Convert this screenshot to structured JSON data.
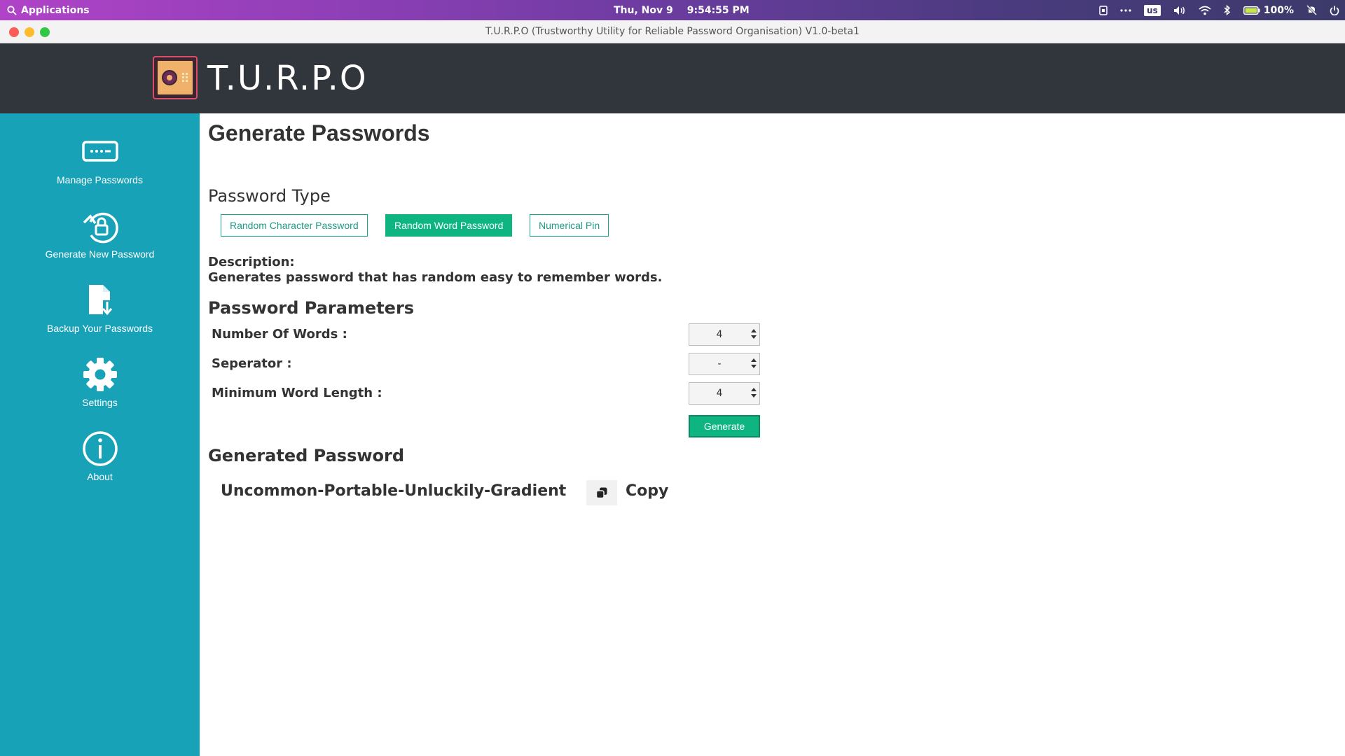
{
  "system_bar": {
    "applications_label": "Applications",
    "date": "Thu, Nov 9",
    "time": "9:54:55 PM",
    "keyboard_layout": "us",
    "battery": "100%"
  },
  "window": {
    "title": "T.U.R.P.O (Trustworthy Utility for Reliable Password Organisation) V1.0-beta1"
  },
  "app": {
    "name": "T.U.R.P.O"
  },
  "sidebar": {
    "items": [
      {
        "label": "Manage Passwords",
        "icon": "password-dots-icon"
      },
      {
        "label": "Generate New Password",
        "icon": "rotate-lock-icon"
      },
      {
        "label": "Backup Your Passwords",
        "icon": "file-download-icon"
      },
      {
        "label": "Settings",
        "icon": "gear-icon"
      },
      {
        "label": "About",
        "icon": "info-icon"
      }
    ]
  },
  "main": {
    "page_title": "Generate Passwords",
    "password_type": {
      "heading": "Password Type",
      "options": [
        "Random Character Password",
        "Random Word Password",
        "Numerical Pin"
      ],
      "selected": "Random Word Password"
    },
    "description": {
      "label": "Description:",
      "text": "Generates password that has random easy to remember words."
    },
    "parameters": {
      "heading": "Password Parameters",
      "fields": [
        {
          "label": "Number Of Words :",
          "value": "4"
        },
        {
          "label": "Seperator :",
          "value": "-"
        },
        {
          "label": "Minimum Word Length :",
          "value": "4"
        }
      ],
      "generate_label": "Generate"
    },
    "generated": {
      "heading": "Generated Password",
      "value": "Uncommon-Portable-Unluckily-Gradient",
      "copy_label": "Copy"
    }
  },
  "colors": {
    "sidebar_bg": "#17a2b8",
    "header_bg": "#31353c",
    "accent_green": "#0fb580"
  }
}
